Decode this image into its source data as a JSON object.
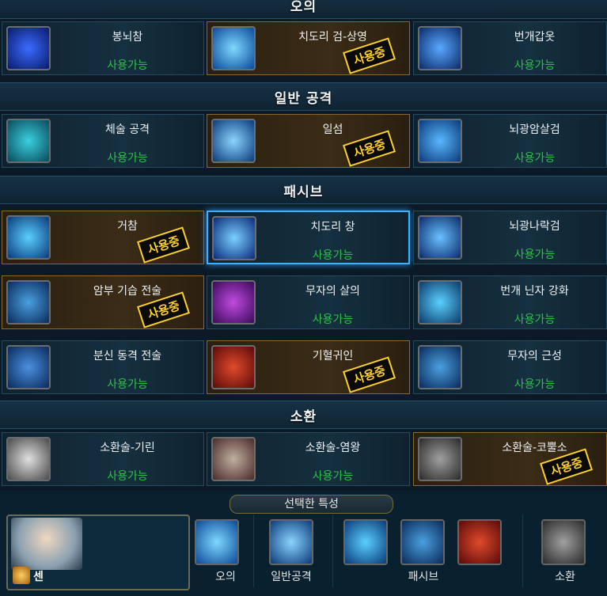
{
  "sections": [
    {
      "title": "오의"
    },
    {
      "title": "일반 공격"
    },
    {
      "title": "패시브"
    },
    {
      "title": "소환"
    }
  ],
  "status_available": "사용가능",
  "status_in_use": "사용중",
  "rows": [
    {
      "cards": [
        {
          "name": "봉뇌참",
          "status": "사용가능"
        },
        {
          "name": "치도리 검-상영",
          "status": "사용중"
        },
        {
          "name": "번개갑옷",
          "status": "사용가능"
        }
      ]
    },
    {
      "cards": [
        {
          "name": "체술 공격",
          "status": "사용가능"
        },
        {
          "name": "일섬",
          "status": "사용중"
        },
        {
          "name": "뇌광암살검",
          "status": "사용가능"
        }
      ]
    },
    {
      "cards": [
        {
          "name": "거참",
          "status": "사용중"
        },
        {
          "name": "치도리 창",
          "status": "사용가능"
        },
        {
          "name": "뇌광나락검",
          "status": "사용가능"
        }
      ]
    },
    {
      "cards": [
        {
          "name": "암부 기습 전술",
          "status": "사용중"
        },
        {
          "name": "무자의 살의",
          "status": "사용가능"
        },
        {
          "name": "번개 닌자 강화",
          "status": "사용가능"
        }
      ]
    },
    {
      "cards": [
        {
          "name": "분신 동격 전술",
          "status": "사용가능"
        },
        {
          "name": "기혈귀인",
          "status": "사용중"
        },
        {
          "name": "무자의 근성",
          "status": "사용가능"
        }
      ]
    },
    {
      "cards": [
        {
          "name": "소환술-기린",
          "status": "사용가능"
        },
        {
          "name": "소환술-염왕",
          "status": "사용가능"
        },
        {
          "name": "소환술-코뿔소",
          "status": "사용중"
        }
      ]
    }
  ],
  "bottom": {
    "title": "선택한 특성",
    "character_name": "센",
    "labels": {
      "ougi": "오의",
      "normal": "일반공격",
      "passive": "패시브",
      "summon": "소환"
    }
  }
}
